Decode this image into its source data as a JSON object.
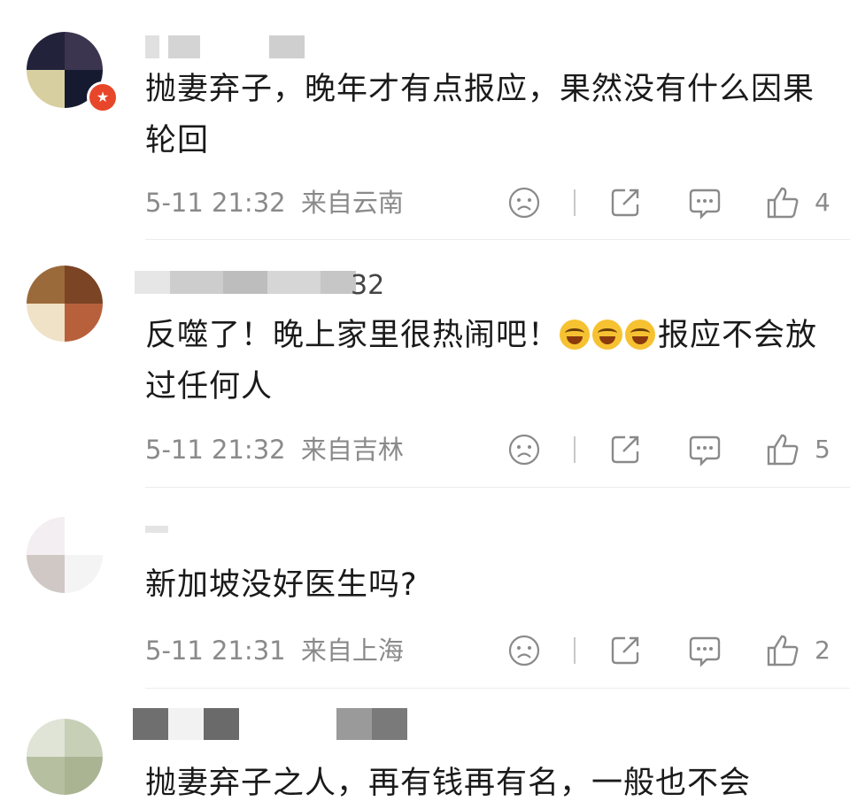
{
  "comments": [
    {
      "name_suffix": "",
      "text": "抛妻弃子，晚年才有点报应，果然没有什么因果轮回",
      "time": "5-11 21:32",
      "location": "来自云南",
      "likes": "4"
    },
    {
      "name_suffix": "32",
      "text_before": "反噬了！晚上家里很热闹吧！",
      "text_after": "报应不会放过任何人",
      "time": "5-11 21:32",
      "location": "来自吉林",
      "likes": "5"
    },
    {
      "name_suffix": "",
      "text": "新加坡没好医生吗?",
      "time": "5-11 21:31",
      "location": "来自上海",
      "likes": "2"
    },
    {
      "name_suffix": "",
      "text": "抛妻弃子之人，再有钱再有名，一般也不会",
      "time": "",
      "location": "",
      "likes": ""
    }
  ],
  "icons": {
    "dislike": "frown-face-icon",
    "share": "share-icon",
    "reply": "comment-bubble-icon",
    "like": "thumbs-up-icon",
    "emoji": "laughing-crying-emoji-icon",
    "badge": "verified-badge-icon"
  },
  "colors": {
    "text": "#1a1a1a",
    "meta": "#8a8a8a",
    "badge": "#e8462a",
    "icon": "#8a8a8a"
  }
}
